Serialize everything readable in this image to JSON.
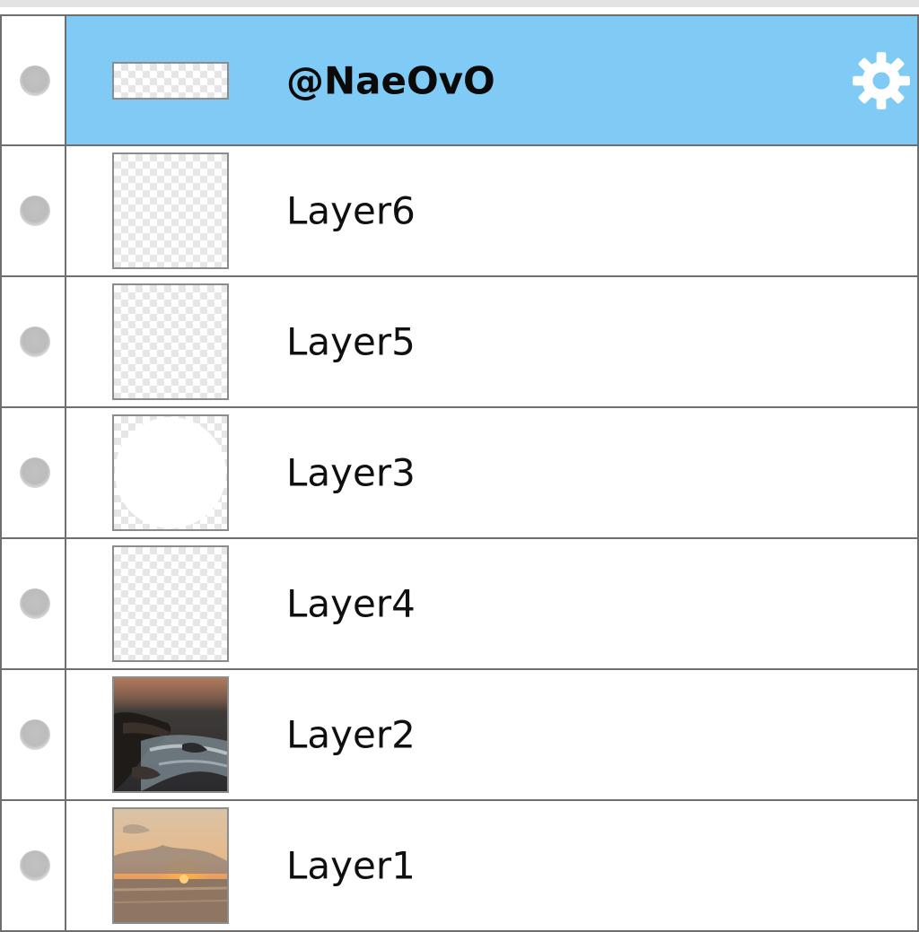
{
  "layers_panel": {
    "layers": [
      {
        "name": "@NaeOvO",
        "selected": true,
        "thumbnail": "transparent-wide",
        "visibility": "hidden"
      },
      {
        "name": "Layer6",
        "selected": false,
        "thumbnail": "transparent",
        "visibility": "hidden"
      },
      {
        "name": "Layer5",
        "selected": false,
        "thumbnail": "transparent",
        "visibility": "hidden"
      },
      {
        "name": "Layer3",
        "selected": false,
        "thumbnail": "white-circle",
        "visibility": "hidden"
      },
      {
        "name": "Layer4",
        "selected": false,
        "thumbnail": "transparent",
        "visibility": "hidden"
      },
      {
        "name": "Layer2",
        "selected": false,
        "thumbnail": "photo-ocean-rocks",
        "visibility": "hidden"
      },
      {
        "name": "Layer1",
        "selected": false,
        "thumbnail": "photo-sunset-sea",
        "visibility": "hidden"
      }
    ],
    "icons": {
      "settings": "gear-icon",
      "visibility": "visibility-dot-icon"
    },
    "colors": {
      "selected_background": "#7fcbf5",
      "border": "#6e6e6e",
      "gear": "#ffffff"
    }
  }
}
